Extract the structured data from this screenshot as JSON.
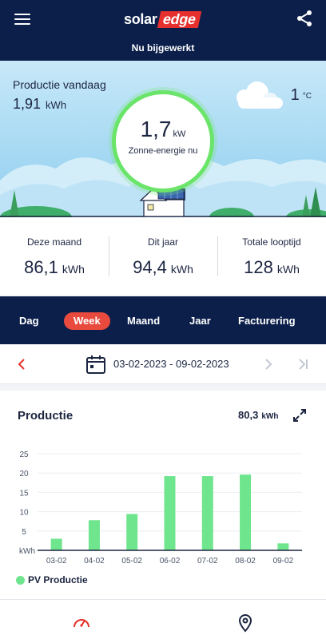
{
  "header": {
    "logo_solar": "solar",
    "logo_edge": "edge",
    "status": "Nu bijgewerkt"
  },
  "scene": {
    "production_label": "Productie vandaag",
    "production_value": "1,91",
    "production_unit": "kWh",
    "temperature_value": "1",
    "temperature_unit": "°C",
    "current_value": "1,7",
    "current_unit": "kW",
    "current_label": "Zonne-energie nu"
  },
  "totals": [
    {
      "label": "Deze maand",
      "value": "86,1",
      "unit": "kWh"
    },
    {
      "label": "Dit jaar",
      "value": "94,4",
      "unit": "kWh"
    },
    {
      "label": "Totale looptijd",
      "value": "128",
      "unit": "kWh"
    }
  ],
  "tabs": [
    {
      "label": "Dag",
      "active": false
    },
    {
      "label": "Week",
      "active": true
    },
    {
      "label": "Maand",
      "active": false
    },
    {
      "label": "Jaar",
      "active": false
    },
    {
      "label": "Facturering",
      "active": false
    }
  ],
  "date_range": "03-02-2023 - 09-02-2023",
  "panel": {
    "title": "Productie",
    "total_value": "80,3",
    "total_unit": "kWh",
    "legend_label": "PV Productie"
  },
  "colors": {
    "navy": "#0c1f4a",
    "accent_red": "#e84a3e",
    "bar_green": "#6fe58e",
    "sun_ring": "#6be46a"
  },
  "icons": {
    "menu": "hamburger-menu-icon",
    "share": "share-icon",
    "calendar": "calendar-icon",
    "prev": "chevron-left-icon",
    "next": "chevron-right-icon",
    "last": "skip-to-end-icon",
    "expand": "expand-icon",
    "dashboard": "speedometer-icon",
    "location": "map-pin-icon"
  },
  "chart_data": {
    "type": "bar",
    "categories": [
      "03-02",
      "04-02",
      "05-02",
      "06-02",
      "07-02",
      "08-02",
      "09-02"
    ],
    "series": [
      {
        "name": "PV Productie",
        "values": [
          3.0,
          7.8,
          9.4,
          19.2,
          19.2,
          19.6,
          1.8
        ]
      }
    ],
    "y_ticks": [
      "25",
      "20",
      "15",
      "10",
      "5"
    ],
    "y_unit_label": "kWh",
    "ylim": [
      0,
      25
    ],
    "grid": true,
    "legend": "bottom-left"
  }
}
